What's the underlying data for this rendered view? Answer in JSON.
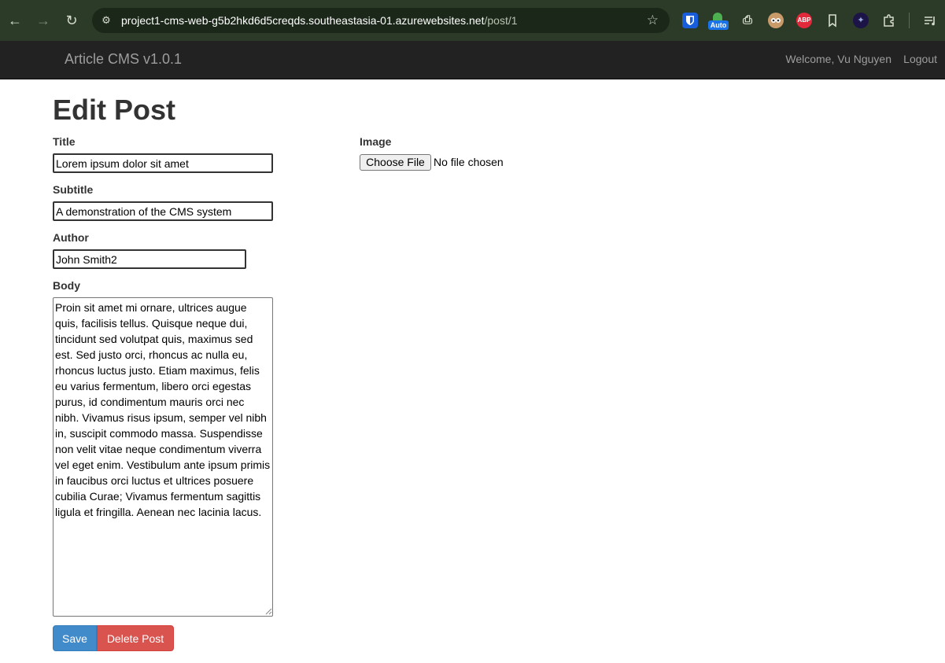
{
  "browser": {
    "url_host": "project1-cms-web-g5b2hkd6d5creqds.southeastasia-01.azurewebsites.net",
    "url_path": "/post/1",
    "nav_icons": [
      "back-icon",
      "forward-icon",
      "reload-icon"
    ],
    "extension_auto_badge": "Auto",
    "extension_abp_label": "ABP"
  },
  "navbar": {
    "brand": "Article CMS v1.0.1",
    "welcome": "Welcome, Vu Nguyen",
    "logout": "Logout",
    "background": "#222222"
  },
  "page": {
    "title": "Edit Post"
  },
  "form": {
    "title_label": "Title",
    "title_value": "Lorem ipsum dolor sit amet",
    "subtitle_label": "Subtitle",
    "subtitle_value": "A demonstration of the CMS system",
    "author_label": "Author",
    "author_value": "John Smith2",
    "body_label": "Body",
    "body_value": "Proin sit amet mi ornare, ultrices augue quis, facilisis tellus. Quisque neque dui, tincidunt sed volutpat quis, maximus sed est. Sed justo orci, rhoncus ac nulla eu, rhoncus luctus justo. Etiam maximus, felis eu varius fermentum, libero orci egestas purus, id condimentum mauris orci nec nibh. Vivamus risus ipsum, semper vel nibh in, suscipit commodo massa. Suspendisse non velit vitae neque condimentum viverra vel eget enim. Vestibulum ante ipsum primis in faucibus orci luctus et ultrices posuere cubilia Curae; Vivamus fermentum sagittis ligula et fringilla. Aenean nec lacinia lacus.",
    "image_label": "Image",
    "choose_file_label": "Choose File",
    "file_status": "No file chosen",
    "save_label": "Save",
    "delete_label": "Delete Post",
    "save_color": "#428bca",
    "delete_color": "#d9534f"
  }
}
